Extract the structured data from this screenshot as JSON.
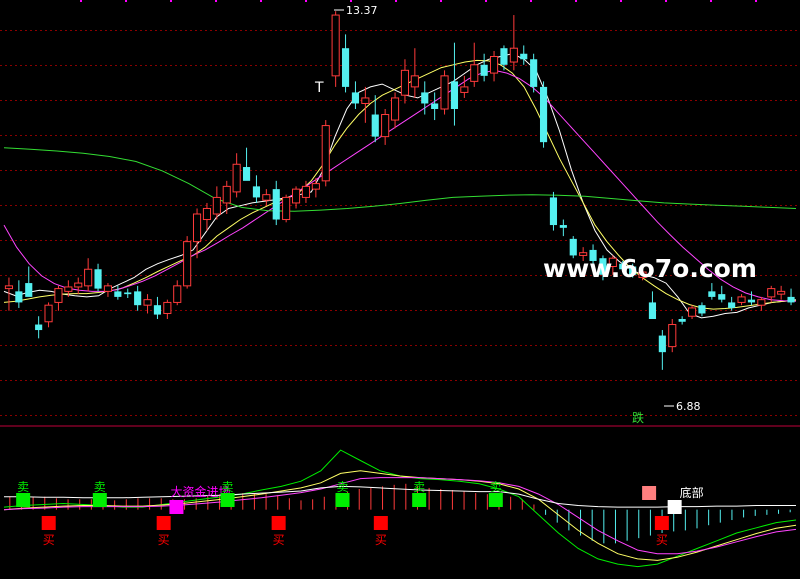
{
  "colors": {
    "background": "#000000",
    "grid": "#8b0000",
    "up_candle": "#ff3b3b",
    "down_candle": "#54f0f0",
    "ma5": "#ffffff",
    "ma10": "#ffff66",
    "ma20": "#ff44ff",
    "ma60": "#33dd33",
    "separator": "#c0003a",
    "sell_box": "#00ee00",
    "buy_box": "#ff0000",
    "magenta_box": "#ff00ff",
    "salmon_box": "#ff7f7f",
    "white_box": "#ffffff"
  },
  "annotations": {
    "high_price": "13.37",
    "low_price": "6.88",
    "t_marker": "T",
    "drop_label": "跌",
    "watermark": "www.6o7o.com",
    "bottom_label": "底部",
    "big_money_label": "大资金进场",
    "sell_label": "卖",
    "buy_label": "买"
  },
  "chart_data": [
    {
      "type": "candlestick",
      "title": "",
      "ylim": [
        5.9,
        13.5
      ],
      "candles": [
        {
          "o": 8.35,
          "h": 8.55,
          "l": 7.95,
          "c": 8.4
        },
        {
          "o": 8.3,
          "h": 8.5,
          "l": 8.0,
          "c": 8.1
        },
        {
          "o": 8.45,
          "h": 8.75,
          "l": 8.25,
          "c": 8.2
        },
        {
          "o": 7.7,
          "h": 7.85,
          "l": 7.45,
          "c": 7.6
        },
        {
          "o": 7.75,
          "h": 8.1,
          "l": 7.65,
          "c": 8.05
        },
        {
          "o": 8.1,
          "h": 8.4,
          "l": 7.95,
          "c": 8.35
        },
        {
          "o": 8.3,
          "h": 8.5,
          "l": 8.2,
          "c": 8.38
        },
        {
          "o": 8.38,
          "h": 8.55,
          "l": 8.25,
          "c": 8.45
        },
        {
          "o": 8.4,
          "h": 8.9,
          "l": 8.3,
          "c": 8.7
        },
        {
          "o": 8.7,
          "h": 8.8,
          "l": 8.3,
          "c": 8.35
        },
        {
          "o": 8.3,
          "h": 8.45,
          "l": 8.2,
          "c": 8.4
        },
        {
          "o": 8.3,
          "h": 8.4,
          "l": 8.15,
          "c": 8.2
        },
        {
          "o": 8.28,
          "h": 8.35,
          "l": 8.18,
          "c": 8.25
        },
        {
          "o": 8.3,
          "h": 8.4,
          "l": 7.95,
          "c": 8.05
        },
        {
          "o": 8.05,
          "h": 8.25,
          "l": 7.9,
          "c": 8.15
        },
        {
          "o": 8.05,
          "h": 8.2,
          "l": 7.8,
          "c": 7.88
        },
        {
          "o": 7.9,
          "h": 8.15,
          "l": 7.8,
          "c": 8.1
        },
        {
          "o": 8.1,
          "h": 8.5,
          "l": 8.05,
          "c": 8.4
        },
        {
          "o": 8.4,
          "h": 9.3,
          "l": 8.35,
          "c": 9.2
        },
        {
          "o": 9.2,
          "h": 9.8,
          "l": 8.9,
          "c": 9.7
        },
        {
          "o": 9.6,
          "h": 9.9,
          "l": 9.4,
          "c": 9.8
        },
        {
          "o": 9.7,
          "h": 10.2,
          "l": 9.6,
          "c": 10.0
        },
        {
          "o": 9.9,
          "h": 10.3,
          "l": 9.7,
          "c": 10.2
        },
        {
          "o": 10.1,
          "h": 10.8,
          "l": 10.0,
          "c": 10.6
        },
        {
          "o": 10.55,
          "h": 10.9,
          "l": 10.4,
          "c": 10.3
        },
        {
          "o": 10.2,
          "h": 10.4,
          "l": 9.9,
          "c": 10.0
        },
        {
          "o": 9.95,
          "h": 10.15,
          "l": 9.85,
          "c": 10.05
        },
        {
          "o": 10.15,
          "h": 10.3,
          "l": 9.5,
          "c": 9.6
        },
        {
          "o": 9.6,
          "h": 10.05,
          "l": 9.55,
          "c": 10.0
        },
        {
          "o": 9.9,
          "h": 10.2,
          "l": 9.8,
          "c": 10.15
        },
        {
          "o": 10.0,
          "h": 10.3,
          "l": 9.9,
          "c": 10.2
        },
        {
          "o": 10.15,
          "h": 10.35,
          "l": 10.0,
          "c": 10.25
        },
        {
          "o": 10.3,
          "h": 11.4,
          "l": 10.2,
          "c": 11.3
        },
        {
          "o": 12.2,
          "h": 13.37,
          "l": 12.0,
          "c": 13.3
        },
        {
          "o": 12.7,
          "h": 12.95,
          "l": 11.9,
          "c": 12.0
        },
        {
          "o": 11.9,
          "h": 12.1,
          "l": 11.6,
          "c": 11.7
        },
        {
          "o": 11.7,
          "h": 12.0,
          "l": 11.35,
          "c": 11.8
        },
        {
          "o": 11.5,
          "h": 11.85,
          "l": 11.0,
          "c": 11.1
        },
        {
          "o": 11.1,
          "h": 11.6,
          "l": 10.95,
          "c": 11.5
        },
        {
          "o": 11.4,
          "h": 11.9,
          "l": 11.25,
          "c": 11.8
        },
        {
          "o": 11.85,
          "h": 12.5,
          "l": 11.7,
          "c": 12.3
        },
        {
          "o": 12.0,
          "h": 12.7,
          "l": 11.8,
          "c": 12.2
        },
        {
          "o": 11.9,
          "h": 12.1,
          "l": 11.5,
          "c": 11.7
        },
        {
          "o": 11.7,
          "h": 11.9,
          "l": 11.4,
          "c": 11.6
        },
        {
          "o": 11.6,
          "h": 12.3,
          "l": 11.5,
          "c": 12.2
        },
        {
          "o": 12.1,
          "h": 12.8,
          "l": 11.3,
          "c": 11.6
        },
        {
          "o": 11.9,
          "h": 12.2,
          "l": 11.8,
          "c": 12.0
        },
        {
          "o": 12.1,
          "h": 12.8,
          "l": 12.0,
          "c": 12.4
        },
        {
          "o": 12.4,
          "h": 12.6,
          "l": 12.1,
          "c": 12.2
        },
        {
          "o": 12.25,
          "h": 12.65,
          "l": 12.1,
          "c": 12.55
        },
        {
          "o": 12.7,
          "h": 12.75,
          "l": 12.3,
          "c": 12.4
        },
        {
          "o": 12.45,
          "h": 13.3,
          "l": 12.3,
          "c": 12.7
        },
        {
          "o": 12.6,
          "h": 12.75,
          "l": 12.4,
          "c": 12.5
        },
        {
          "o": 12.5,
          "h": 12.6,
          "l": 11.9,
          "c": 12.0
        },
        {
          "o": 12.0,
          "h": 12.1,
          "l": 10.9,
          "c": 11.0
        },
        {
          "o": 10.0,
          "h": 10.1,
          "l": 9.4,
          "c": 9.5
        },
        {
          "o": 9.5,
          "h": 9.6,
          "l": 9.3,
          "c": 9.45
        },
        {
          "o": 9.25,
          "h": 9.3,
          "l": 8.9,
          "c": 8.95
        },
        {
          "o": 8.95,
          "h": 9.1,
          "l": 8.85,
          "c": 9.0
        },
        {
          "o": 9.05,
          "h": 9.15,
          "l": 8.8,
          "c": 8.85
        },
        {
          "o": 8.9,
          "h": 8.95,
          "l": 8.5,
          "c": 8.6
        },
        {
          "o": 8.75,
          "h": 8.95,
          "l": 8.6,
          "c": 8.9
        },
        {
          "o": 8.8,
          "h": 8.85,
          "l": 8.65,
          "c": 8.7
        },
        {
          "o": 8.75,
          "h": 8.8,
          "l": 8.55,
          "c": 8.6
        },
        {
          "o": 8.55,
          "h": 8.7,
          "l": 8.5,
          "c": 8.65
        },
        {
          "o": 8.1,
          "h": 8.3,
          "l": 7.9,
          "c": 7.8
        },
        {
          "o": 7.5,
          "h": 7.6,
          "l": 6.88,
          "c": 7.2
        },
        {
          "o": 7.3,
          "h": 7.8,
          "l": 7.2,
          "c": 7.7
        },
        {
          "o": 7.8,
          "h": 7.85,
          "l": 7.7,
          "c": 7.75
        },
        {
          "o": 7.85,
          "h": 8.05,
          "l": 7.8,
          "c": 8.0
        },
        {
          "o": 8.05,
          "h": 8.1,
          "l": 7.85,
          "c": 7.9
        },
        {
          "o": 8.3,
          "h": 8.45,
          "l": 8.15,
          "c": 8.2
        },
        {
          "o": 8.25,
          "h": 8.4,
          "l": 8.1,
          "c": 8.15
        },
        {
          "o": 8.1,
          "h": 8.2,
          "l": 7.95,
          "c": 8.0
        },
        {
          "o": 8.1,
          "h": 8.25,
          "l": 8.05,
          "c": 8.2
        },
        {
          "o": 8.15,
          "h": 8.3,
          "l": 8.05,
          "c": 8.1
        },
        {
          "o": 8.05,
          "h": 8.2,
          "l": 7.95,
          "c": 8.15
        },
        {
          "o": 8.2,
          "h": 8.4,
          "l": 8.1,
          "c": 8.35
        },
        {
          "o": 8.25,
          "h": 8.4,
          "l": 8.15,
          "c": 8.3
        },
        {
          "o": 8.2,
          "h": 8.35,
          "l": 8.05,
          "c": 8.1
        }
      ],
      "series": [
        {
          "values": [
            8.3,
            8.22,
            8.28,
            8.32,
            8.3,
            8.25,
            8.22,
            8.2,
            8.22,
            8.35,
            8.45,
            8.55,
            8.7,
            8.8,
            8.88,
            8.95,
            9.05,
            9.35,
            9.65,
            9.8,
            9.85,
            9.9,
            9.93,
            9.96,
            10.0,
            10.05,
            10.1,
            10.5,
            11.1,
            11.6,
            11.9,
            12.0,
            12.05,
            11.95,
            11.85,
            11.8,
            11.9,
            12.0,
            12.1,
            12.25,
            12.4,
            12.5,
            12.55,
            12.6,
            12.5,
            12.3,
            11.8,
            11.2,
            10.5,
            9.9,
            9.4,
            9.05,
            8.85,
            8.7,
            8.6,
            8.55,
            8.45,
            8.2,
            7.9,
            7.82,
            7.85,
            7.9,
            7.92,
            8.0,
            8.05,
            8.1,
            8.12,
            8.15
          ]
        },
        {
          "values": [
            8.1,
            8.12,
            8.16,
            8.2,
            8.23,
            8.25,
            8.26,
            8.26,
            8.28,
            8.31,
            8.36,
            8.45,
            8.55,
            8.66,
            8.76,
            8.86,
            8.95,
            9.1,
            9.3,
            9.45,
            9.6,
            9.72,
            9.82,
            9.92,
            10.0,
            10.1,
            10.3,
            10.6,
            10.95,
            11.25,
            11.5,
            11.7,
            11.85,
            11.95,
            12.05,
            12.15,
            12.25,
            12.35,
            12.4,
            12.45,
            12.48,
            12.47,
            12.4,
            12.25,
            12.0,
            11.6,
            11.15,
            10.7,
            10.3,
            9.9,
            9.5,
            9.2,
            8.95,
            8.72,
            8.55,
            8.4,
            8.26,
            8.15,
            8.06,
            8.0,
            7.98,
            7.99,
            8.01,
            8.04,
            8.07,
            8.1,
            8.12,
            8.14
          ]
        },
        {
          "values": [
            9.5,
            9.1,
            8.8,
            8.58,
            8.44,
            8.36,
            8.32,
            8.3,
            8.3,
            8.33,
            8.4,
            8.48,
            8.58,
            8.7,
            8.82,
            8.95,
            9.05,
            9.18,
            9.32,
            9.45,
            9.6,
            9.75,
            9.9,
            10.05,
            10.2,
            10.35,
            10.5,
            10.65,
            10.8,
            10.95,
            11.1,
            11.25,
            11.4,
            11.55,
            11.7,
            11.85,
            12.0,
            12.15,
            12.25,
            12.3,
            12.25,
            12.15,
            12.0,
            11.8,
            11.55,
            11.3,
            11.05,
            10.8,
            10.55,
            10.3,
            10.05,
            9.8,
            9.55,
            9.32,
            9.1,
            8.9,
            8.7,
            8.52,
            8.38,
            8.27,
            8.2,
            8.15,
            8.13,
            8.12
          ]
        },
        {
          "values": [
            10.9,
            10.87,
            10.84,
            10.8,
            10.74,
            10.65,
            10.48,
            10.25,
            9.98,
            9.82,
            9.76,
            9.75,
            9.77,
            9.8,
            9.84,
            9.89,
            9.95,
            10.0,
            10.02,
            10.04,
            10.05,
            10.04,
            10.02,
            9.98,
            9.94,
            9.9,
            9.88,
            9.86,
            9.84,
            9.82,
            9.8
          ]
        }
      ]
    },
    {
      "type": "line",
      "title": "",
      "ylim": [
        -1.3,
        1.5
      ],
      "histogram": [
        0.25,
        0.25,
        0.25,
        0.25,
        0.22,
        0.2,
        0.2,
        0.2,
        0.18,
        0.18,
        0.2,
        0.22,
        0.22,
        0.22,
        0.2,
        0.2,
        0.22,
        0.25,
        0.28,
        0.3,
        0.32,
        0.32,
        0.3,
        0.28,
        0.22,
        0.18,
        0.2,
        0.25,
        0.3,
        0.35,
        0.4,
        0.42,
        0.45,
        0.48,
        0.5,
        0.45,
        0.42,
        0.4,
        0.38,
        0.35,
        0.32,
        0.3,
        0.28,
        0.25,
        0.2,
        0.1,
        -0.1,
        -0.25,
        -0.4,
        -0.5,
        -0.6,
        -0.65,
        -0.65,
        -0.6,
        -0.55,
        -0.5,
        -0.45,
        -0.42,
        -0.4,
        -0.36,
        -0.3,
        -0.25,
        -0.2,
        -0.15,
        -0.12,
        -0.1,
        -0.08,
        -0.05
      ],
      "series": [
        {
          "values": [
            0.05,
            0.08,
            0.1,
            0.12,
            0.1,
            0.08,
            0.05,
            0.05,
            0.1,
            0.15,
            0.2,
            0.25,
            0.3,
            0.38,
            0.45,
            0.55,
            0.75,
            1.15,
            0.95,
            0.75,
            0.65,
            0.6,
            0.58,
            0.55,
            0.5,
            0.4,
            0.25,
            -0.1,
            -0.45,
            -0.75,
            -0.95,
            -1.05,
            -1.1,
            -1.05,
            -0.9,
            -0.75,
            -0.6,
            -0.45,
            -0.35,
            -0.25,
            -0.2
          ]
        },
        {
          "values": [
            0.0,
            0.03,
            0.05,
            0.07,
            0.08,
            0.08,
            0.07,
            0.07,
            0.09,
            0.12,
            0.16,
            0.2,
            0.25,
            0.3,
            0.36,
            0.42,
            0.52,
            0.7,
            0.75,
            0.7,
            0.65,
            0.62,
            0.6,
            0.58,
            0.55,
            0.5,
            0.4,
            0.2,
            -0.1,
            -0.4,
            -0.65,
            -0.85,
            -0.95,
            -0.98,
            -0.92,
            -0.82,
            -0.7,
            -0.58,
            -0.46,
            -0.36,
            -0.3
          ]
        },
        {
          "values": [
            0.0,
            0.02,
            0.03,
            0.05,
            0.06,
            0.06,
            0.06,
            0.06,
            0.07,
            0.09,
            0.12,
            0.15,
            0.19,
            0.23,
            0.28,
            0.33,
            0.4,
            0.5,
            0.6,
            0.62,
            0.62,
            0.62,
            0.6,
            0.58,
            0.56,
            0.52,
            0.45,
            0.3,
            0.1,
            -0.15,
            -0.4,
            -0.6,
            -0.78,
            -0.85,
            -0.85,
            -0.8,
            -0.72,
            -0.62,
            -0.52,
            -0.43,
            -0.38
          ]
        },
        {
          "values": [
            0.25,
            0.25,
            0.24,
            0.24,
            0.23,
            0.23,
            0.23,
            0.24,
            0.25,
            0.26,
            0.27,
            0.28,
            0.3,
            0.32,
            0.34,
            0.36,
            0.42,
            0.45,
            0.44,
            0.42,
            0.4,
            0.38,
            0.37,
            0.36,
            0.35,
            0.35,
            0.3,
            0.2,
            0.12,
            0.08,
            0.06,
            0.05,
            0.05,
            0.05,
            0.06,
            0.06,
            0.07,
            0.07,
            0.08,
            0.08,
            0.08
          ]
        }
      ],
      "signals": [
        {
          "kind": "sell",
          "label": "卖",
          "bar": 1
        },
        {
          "kind": "buy",
          "label": "买",
          "bar": 3
        },
        {
          "kind": "sell",
          "label": "卖",
          "bar": 7
        },
        {
          "kind": "buy",
          "label": "买",
          "bar": 12
        },
        {
          "kind": "big",
          "label": "大资金进场",
          "bar": 13
        },
        {
          "kind": "sell",
          "label": "卖",
          "bar": 17
        },
        {
          "kind": "buy",
          "label": "买",
          "bar": 21
        },
        {
          "kind": "sell",
          "label": "卖",
          "bar": 26
        },
        {
          "kind": "buy",
          "label": "买",
          "bar": 29
        },
        {
          "kind": "sell",
          "label": "卖",
          "bar": 32
        },
        {
          "kind": "sell",
          "label": "卖",
          "bar": 38
        },
        {
          "kind": "salmon",
          "label": "",
          "bar": 50
        },
        {
          "kind": "buy",
          "label": "买",
          "bar": 51
        },
        {
          "kind": "bottom",
          "label": "底部",
          "bar": 52
        }
      ]
    }
  ]
}
